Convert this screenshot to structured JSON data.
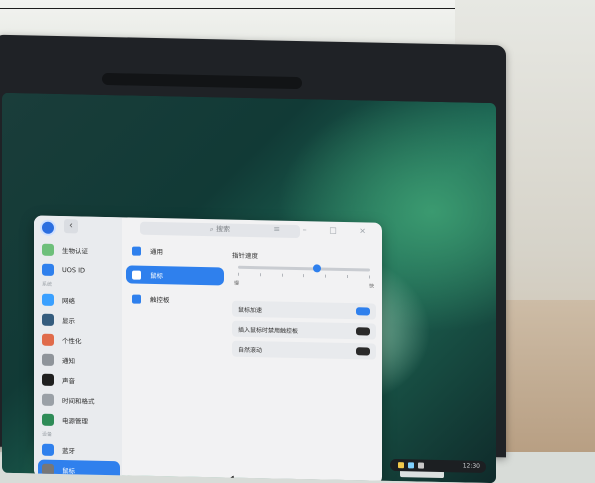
{
  "window": {
    "search_placeholder": "搜索",
    "back": "‹",
    "controls": "≡ – □ ×"
  },
  "sidebar": {
    "items": [
      {
        "label": "生物认证",
        "icon": "fingerprint-icon",
        "color": "#6dbf7a"
      },
      {
        "label": "UOS ID",
        "icon": "cloud-icon",
        "color": "#2f80ed"
      },
      {
        "group": "系统"
      },
      {
        "label": "网络",
        "icon": "globe-icon",
        "color": "#3aa0ff"
      },
      {
        "label": "显示",
        "icon": "monitor-icon",
        "color": "#355c7d"
      },
      {
        "label": "个性化",
        "icon": "palette-icon",
        "color": "#e06b4a"
      },
      {
        "label": "通知",
        "icon": "bell-icon",
        "color": "#8f949a"
      },
      {
        "label": "声音",
        "icon": "speaker-icon",
        "color": "#1f1f1f"
      },
      {
        "label": "时间和格式",
        "icon": "clock-icon",
        "color": "#9aa0a6"
      },
      {
        "label": "电源管理",
        "icon": "power-icon",
        "color": "#2e8b57"
      },
      {
        "group": "设备"
      },
      {
        "label": "蓝牙",
        "icon": "bluetooth-icon",
        "color": "#2f80ed"
      },
      {
        "label": "鼠标",
        "icon": "mouse-icon",
        "color": "#777"
      }
    ]
  },
  "middle": {
    "items": [
      {
        "label": "通用",
        "icon": "gear-icon",
        "color": "#2f80ed"
      },
      {
        "label": "鼠标",
        "icon": "mouse-icon",
        "color": "#ffffff"
      },
      {
        "label": "触控板",
        "icon": "touchpad-icon",
        "color": "#2f80ed"
      }
    ]
  },
  "detail": {
    "pointer_speed_label": "指针速度",
    "pointer_speed_value": 0.6,
    "slow": "慢",
    "fast": "快",
    "rows": [
      {
        "label": "鼠标加速",
        "state": "on"
      },
      {
        "label": "插入鼠标时禁用触控板",
        "state": "off"
      },
      {
        "label": "自然滚动",
        "state": "off"
      }
    ],
    "toggle_on_color": "#2f80ed",
    "toggle_off_color": "#2a2a2a"
  },
  "taskbar": {
    "time": "12:30"
  }
}
